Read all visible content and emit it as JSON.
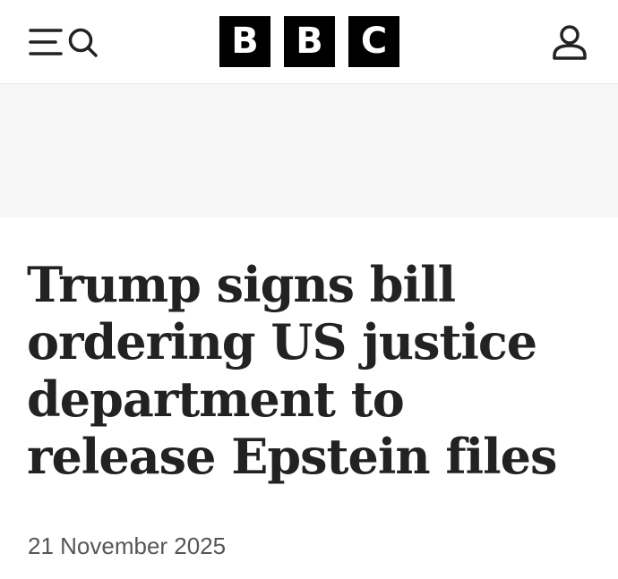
{
  "header": {
    "menu_icon": "menu-icon",
    "search_icon": "search-icon",
    "account_icon": "user-account-icon",
    "logo_letters": [
      "B",
      "B",
      "C"
    ],
    "logo_color": "#000000"
  },
  "article": {
    "headline_lines": [
      "Trump signs bill",
      "ordering US justice",
      "department to",
      "release Epstein files"
    ],
    "date": "21 November 2025"
  },
  "colors": {
    "headline": "#222222",
    "date": "#545658",
    "ad_background": "#f6f6f6"
  }
}
